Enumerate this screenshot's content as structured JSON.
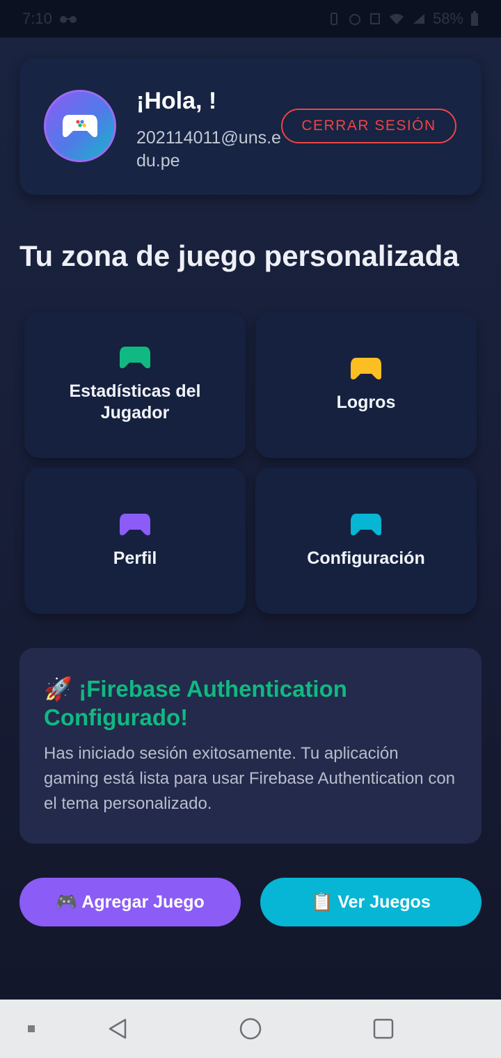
{
  "status_bar": {
    "time": "7:10",
    "battery": "58%"
  },
  "header": {
    "greeting": "¡Hola, !",
    "email": "202114011@uns.edu.pe",
    "logout_label": "CERRAR SESIÓN"
  },
  "section_title": "Tu zona de juego personalizada",
  "tiles": [
    {
      "label": "Estadísticas del Jugador",
      "icon": "gamepad-icon",
      "color": "#10b981"
    },
    {
      "label": "Logros",
      "icon": "gamepad-icon",
      "color": "#fbbf24"
    },
    {
      "label": "Perfil",
      "icon": "gamepad-icon",
      "color": "#8b5cf6"
    },
    {
      "label": "Configuración",
      "icon": "gamepad-icon",
      "color": "#06b6d4"
    }
  ],
  "info": {
    "title": "🚀 ¡Firebase Authentication Configurado!",
    "text": "Has iniciado sesión exitosamente. Tu aplicación gaming está lista para usar Firebase Authentication con el tema personalizado."
  },
  "buttons": {
    "add_label": "🎮 Agregar Juego",
    "view_label": "📋 Ver Juegos"
  },
  "colors": {
    "accent_purple": "#8b5cf6",
    "accent_cyan": "#06b6d4",
    "success_green": "#10b981",
    "danger_red": "#ef4444"
  }
}
